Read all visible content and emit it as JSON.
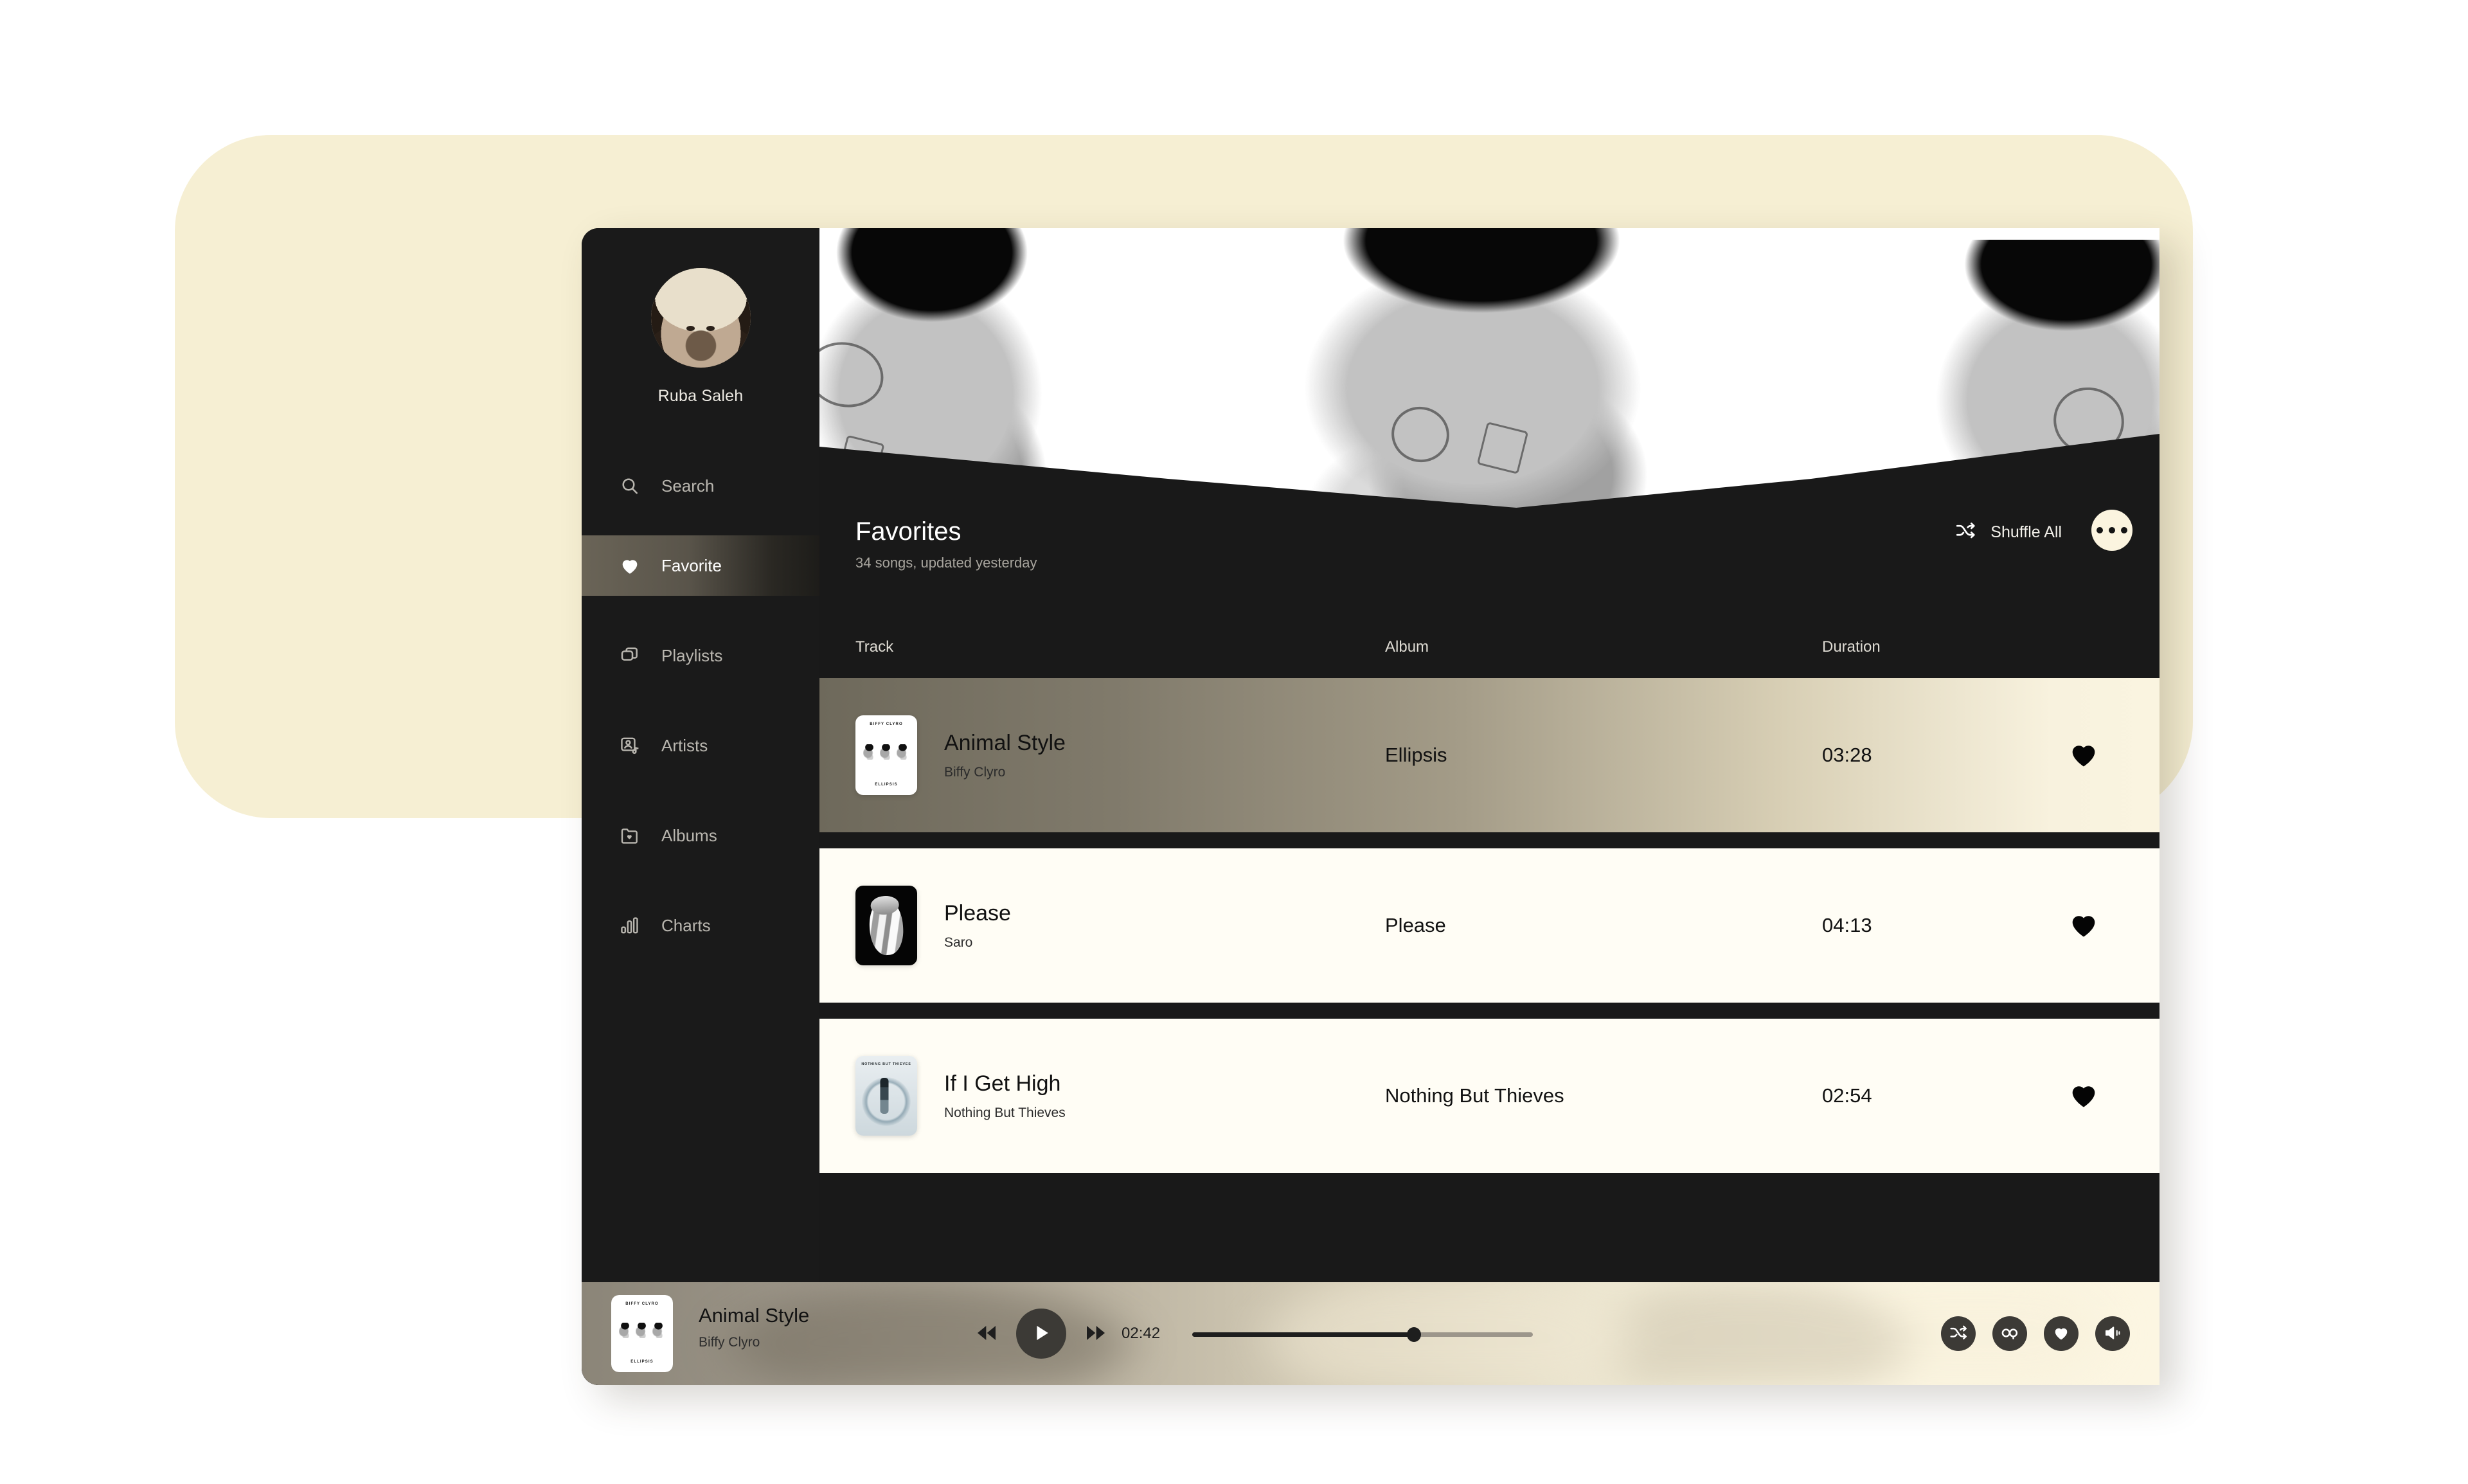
{
  "app": {
    "accent_cream": "#F6EFD3",
    "dark": "#191919",
    "row_bg": "#FFFDF5"
  },
  "sidebar": {
    "user_name": "Ruba Saleh",
    "avatar_name": "user-avatar",
    "items": [
      {
        "label": "Search",
        "icon": "search-icon",
        "active": false
      },
      {
        "label": "Favorite",
        "icon": "heart-icon",
        "active": true
      },
      {
        "label": "Playlists",
        "icon": "playlists-icon",
        "active": false
      },
      {
        "label": "Artists",
        "icon": "artists-icon",
        "active": false
      },
      {
        "label": "Albums",
        "icon": "albums-icon",
        "active": false
      },
      {
        "label": "Charts",
        "icon": "charts-icon",
        "active": false
      }
    ]
  },
  "header": {
    "title": "Favorites",
    "subtitle": "34 songs, updated yesterday",
    "shuffle_label": "Shuffle All",
    "more_label": "..."
  },
  "columns": {
    "track": "Track",
    "album": "Album",
    "duration": "Duration"
  },
  "tracks": [
    {
      "title": "Animal Style",
      "artist": "Biffy Clyro",
      "album": "Ellipsis",
      "duration": "03:28",
      "favorited": true,
      "cover": "ellipsis-cover",
      "cover_top_text": "BIFFY CLYRO",
      "cover_bottom_text": "ELLIPSIS",
      "playing": true
    },
    {
      "title": "Please",
      "artist": "Saro",
      "album": "Please",
      "duration": "04:13",
      "favorited": true,
      "cover": "please-cover",
      "playing": false
    },
    {
      "title": "If I Get High",
      "artist": "Nothing But Thieves",
      "album": "Nothing But Thieves",
      "duration": "02:54",
      "favorited": true,
      "cover": "nothing-but-thieves-cover",
      "cover_top_text": "NOTHING BUT THIEVES",
      "playing": false
    }
  ],
  "player": {
    "title": "Animal Style",
    "artist": "Biffy Clyro",
    "elapsed": "02:42",
    "progress_percent": 65,
    "cover_top_text": "BIFFY CLYRO",
    "cover_bottom_text": "ELLIPSIS",
    "controls": {
      "previous": "rewind-icon",
      "play": "play-icon",
      "next": "fast-forward-icon"
    },
    "right_actions": [
      {
        "icon": "shuffle-icon"
      },
      {
        "icon": "repeat-icon"
      },
      {
        "icon": "heart-icon"
      },
      {
        "icon": "volume-icon"
      }
    ]
  }
}
